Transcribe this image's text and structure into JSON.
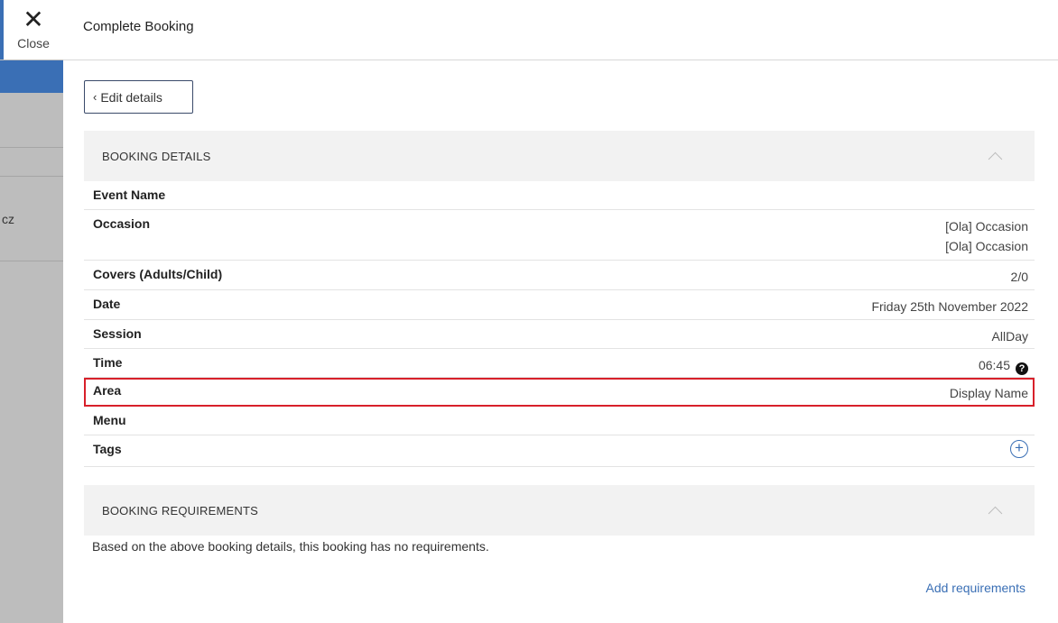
{
  "window": {
    "close_label": "Close",
    "close_icon": "close-icon",
    "title": "Complete Booking"
  },
  "background": {
    "partial_text": "cz"
  },
  "edit_button": {
    "label": "Edit details",
    "icon": "chevron-left-icon"
  },
  "booking_details": {
    "header": "BOOKING DETAILS",
    "rows": [
      {
        "key": "Event Name",
        "value": ""
      },
      {
        "key": "Occasion",
        "value": "[Ola] Occasion",
        "value2": "[Ola] Occasion"
      },
      {
        "key": "Covers (Adults/Child)",
        "value": "2/0"
      },
      {
        "key": "Date",
        "value": "Friday 25th November 2022"
      },
      {
        "key": "Session",
        "value": "AllDay"
      },
      {
        "key": "Time",
        "value": "06:45"
      },
      {
        "key": "Area",
        "value": "Display Name"
      },
      {
        "key": "Menu",
        "value": ""
      },
      {
        "key": "Tags",
        "value": ""
      }
    ]
  },
  "booking_requirements": {
    "header": "BOOKING REQUIREMENTS",
    "text": "Based on the above booking details, this booking has no requirements.",
    "add_label": "Add requirements"
  },
  "colors": {
    "accent": "#3a6fb5",
    "highlight": "#d8202a",
    "section_bg": "#f2f2f2"
  }
}
